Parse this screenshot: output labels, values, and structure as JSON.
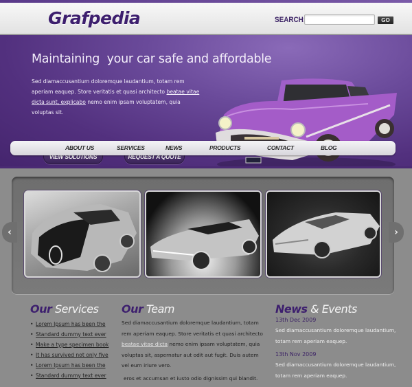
{
  "header": {
    "logo": "Grafpedia",
    "search_label": "SEARCH:",
    "search_value": "",
    "search_placeholder": "",
    "go_label": "GO"
  },
  "hero": {
    "title": "Maintaining  your car safe and affordable",
    "text_before_link": "Sed diamaccusantium doloremque laudantium, totam rem aperiam eaquep. Store veritatis et quasi architecto ",
    "link_text": "beatae vitae dicta sunt, explicabo",
    "text_after_link": " nemo enim ipsam voluptatem, quia voluptas sit.",
    "buttons": [
      "VIEW SOLUTIONS",
      "REQUEST A QUOTE"
    ],
    "image": "purple-classic-car"
  },
  "nav": {
    "items": [
      "ABOUT US",
      "SERVICES",
      "NEWS",
      "PRODUCTS",
      "CONTACT",
      "BLOG"
    ]
  },
  "gallery": {
    "prev_icon": "chevron-left-icon",
    "next_icon": "chevron-right-icon",
    "prev_glyph": "‹",
    "next_glyph": "›",
    "images": [
      "bugatti-veyron-bw",
      "lamborghini-gallardo-bw",
      "ferrari-enzo-bw"
    ]
  },
  "services": {
    "title_a": "Our",
    "title_b": " Services",
    "items": [
      "Lorem Ipsum has been the",
      "Standard dummy text ever",
      "Make a type specimen book",
      "It has survived not only five",
      "Lorem Ipsum has been the",
      "Standard dummy text ever"
    ]
  },
  "team": {
    "title_a": "Our",
    "title_b": " Team",
    "text_before_link": "Sed diamaccusantium doloremque laudantium, totam rem aperiam eaquep. Store veritatis et quasi architecto ",
    "link_text": "beatae vitae dicta",
    "text_after_link": " nemo enim ipsam voluptatem, quia voluptas sit, aspernatur aut odit aut fugit. Duis autem vel eum iriure vero.",
    "text_p2": "eros et accumsan et iusto odio dignissim qui blandit."
  },
  "news": {
    "title_a": "News",
    "title_b": " & Events",
    "items": [
      {
        "date": "13th Dec 2009",
        "text": "Sed diamaccusantium doloremque laudantium, totam rem aperiam eaquep."
      },
      {
        "date": "13th Nov 2009",
        "text": "Sed diamaccusantium doloremque laudantium, totam rem aperiam eaquep."
      }
    ]
  },
  "colors": {
    "brand_purple": "#3d1f6e",
    "hero_purple": "#6a4a9a",
    "page_gray": "#8a8a8a"
  }
}
